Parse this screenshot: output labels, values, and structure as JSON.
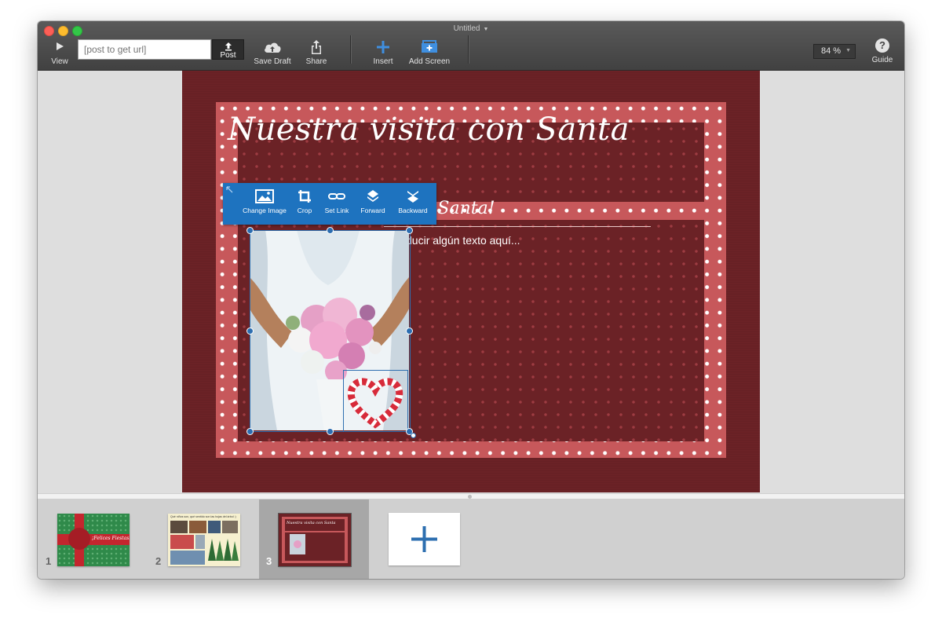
{
  "window": {
    "title": "Untitled"
  },
  "toolbar": {
    "view_label": "View",
    "url_placeholder": "[post to get url]",
    "post_label": "Post",
    "save_draft_label": "Save Draft",
    "share_label": "Share",
    "insert_label": "Insert",
    "add_screen_label": "Add Screen",
    "zoom_value": "84 %",
    "guide_label": "Guide",
    "guide_glyph": "?"
  },
  "image_toolbar": {
    "items": [
      {
        "label": "Change Image",
        "icon": "image-icon"
      },
      {
        "label": "Crop",
        "icon": "crop-icon"
      },
      {
        "label": "Set Link",
        "icon": "link-icon"
      },
      {
        "label": "Forward",
        "icon": "forward-layer-icon"
      },
      {
        "label": "Backward",
        "icon": "backward-layer-icon"
      }
    ]
  },
  "slide": {
    "title": "Nuestra visita con Santa",
    "subheading": "¡Hola Santa!",
    "body_text": "Introducir algún texto aquí..."
  },
  "filmstrip": {
    "thumbnails": [
      {
        "number": "1",
        "caption": "¡Felices Fiestas!"
      },
      {
        "number": "2",
        "caption": "Qué niños son, qué sentido son las hojas del árbol :)"
      },
      {
        "number": "3",
        "caption": "Nuestra visita con Santa"
      }
    ],
    "add_glyph": "+",
    "selected_index": 3
  },
  "colors": {
    "toolbar": "#474747",
    "slide_background": "#6b2226",
    "frame": "#c7585b",
    "selection_blue": "#1e73bf",
    "add_plus": "#2d6fb0"
  }
}
